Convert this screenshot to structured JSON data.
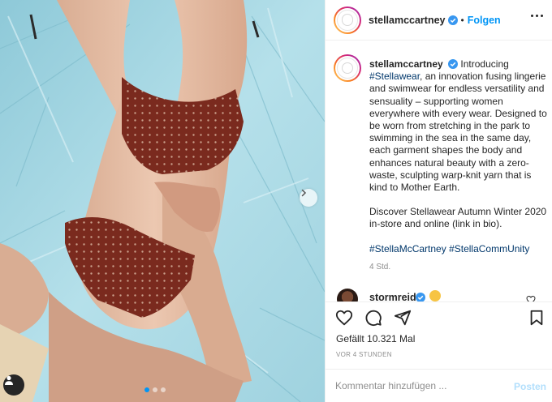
{
  "post": {
    "username": "stellamccartney",
    "follow_label": "Folgen",
    "bullet": "•",
    "caption": {
      "p1_pre": "Introducing ",
      "p1_tag": "#Stellawear",
      "p1_post": ", an innovation fusing lingerie and swimwear for endless versatility and sensuality – supporting women everywhere with every wear. Designed to be worn from stretching in the park to swimming in the sea in the same day, each garment shapes the body and enhances natural beauty with a zero-waste, sculpting warp-knit yarn that is kind to Mother Earth.",
      "p2": "Discover Stellawear Autumn Winter 2020 in-store and online (link in bio).",
      "tag1": "#StellaMcCartney",
      "tag2": "#StellaCommUnity"
    },
    "time": "4 Std."
  },
  "comment": {
    "username": "stormreid",
    "emoji_icon": "heart-eyes-emoji-icon"
  },
  "actions": {
    "likes": "Gefällt 10.321 Mal",
    "ago": "VOR 4 STUNDEN",
    "comment_placeholder": "Kommentar hinzufügen ...",
    "post_label": "Posten"
  },
  "carousel": {
    "slide_count": 3,
    "active_index": 0
  },
  "colors": {
    "link_blue": "#0095f6",
    "hashtag": "#00376b",
    "verified": "#3897f0",
    "post_disabled": "#b2dffc",
    "tarp": "#a9d8e4",
    "swimwear": "#7a2a1e"
  }
}
